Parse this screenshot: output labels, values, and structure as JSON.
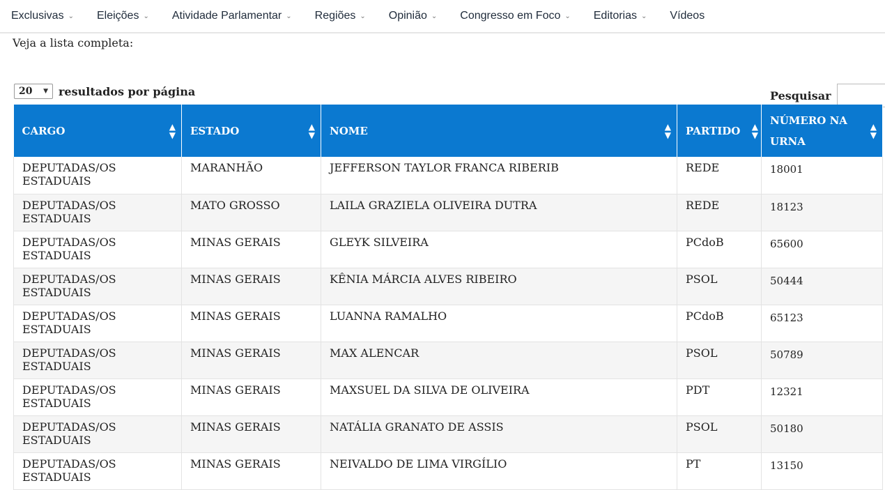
{
  "nav": {
    "items": [
      {
        "label": "Exclusivas",
        "dropdown": true
      },
      {
        "label": "Eleições",
        "dropdown": true
      },
      {
        "label": "Atividade Parlamentar",
        "dropdown": true
      },
      {
        "label": "Regiões",
        "dropdown": true
      },
      {
        "label": "Opinião",
        "dropdown": true
      },
      {
        "label": "Congresso em Foco",
        "dropdown": true
      },
      {
        "label": "Editorias",
        "dropdown": true
      },
      {
        "label": "Vídeos",
        "dropdown": false
      }
    ],
    "chevron": "⌄"
  },
  "intro_text": "Veja a lista completa:",
  "length_control": {
    "value": "20",
    "label": "resultados por página"
  },
  "search": {
    "label": "Pesquisar",
    "value": ""
  },
  "table": {
    "headers": [
      "CARGO",
      "ESTADO",
      "NOME",
      "PARTIDO",
      "NÚMERO NA URNA"
    ],
    "rows": [
      [
        "DEPUTADAS/OS ESTADUAIS",
        "MARANHÃO",
        "JEFFERSON TAYLOR FRANCA RIBERIB",
        "REDE",
        "18001"
      ],
      [
        "DEPUTADAS/OS ESTADUAIS",
        "MATO GROSSO",
        "LAILA GRAZIELA OLIVEIRA DUTRA",
        "REDE",
        "18123"
      ],
      [
        "DEPUTADAS/OS ESTADUAIS",
        "MINAS GERAIS",
        "GLEYK SILVEIRA",
        "PCdoB",
        "65600"
      ],
      [
        "DEPUTADAS/OS ESTADUAIS",
        "MINAS GERAIS",
        "KÊNIA MÁRCIA ALVES RIBEIRO",
        "PSOL",
        "50444"
      ],
      [
        "DEPUTADAS/OS ESTADUAIS",
        "MINAS GERAIS",
        "LUANNA RAMALHO",
        "PCdoB",
        "65123"
      ],
      [
        "DEPUTADAS/OS ESTADUAIS",
        "MINAS GERAIS",
        "MAX ALENCAR",
        "PSOL",
        "50789"
      ],
      [
        "DEPUTADAS/OS ESTADUAIS",
        "MINAS GERAIS",
        "MAXSUEL DA SILVA DE OLIVEIRA",
        "PDT",
        "12321"
      ],
      [
        "DEPUTADAS/OS ESTADUAIS",
        "MINAS GERAIS",
        "NATÁLIA GRANATO DE ASSIS",
        "PSOL",
        "50180"
      ],
      [
        "DEPUTADAS/OS ESTADUAIS",
        "MINAS GERAIS",
        "NEIVALDO DE LIMA VIRGÍLIO",
        "PT",
        "13150"
      ]
    ]
  },
  "colors": {
    "header_bg": "#0b79d0",
    "stripe": "#f5f5f5"
  }
}
